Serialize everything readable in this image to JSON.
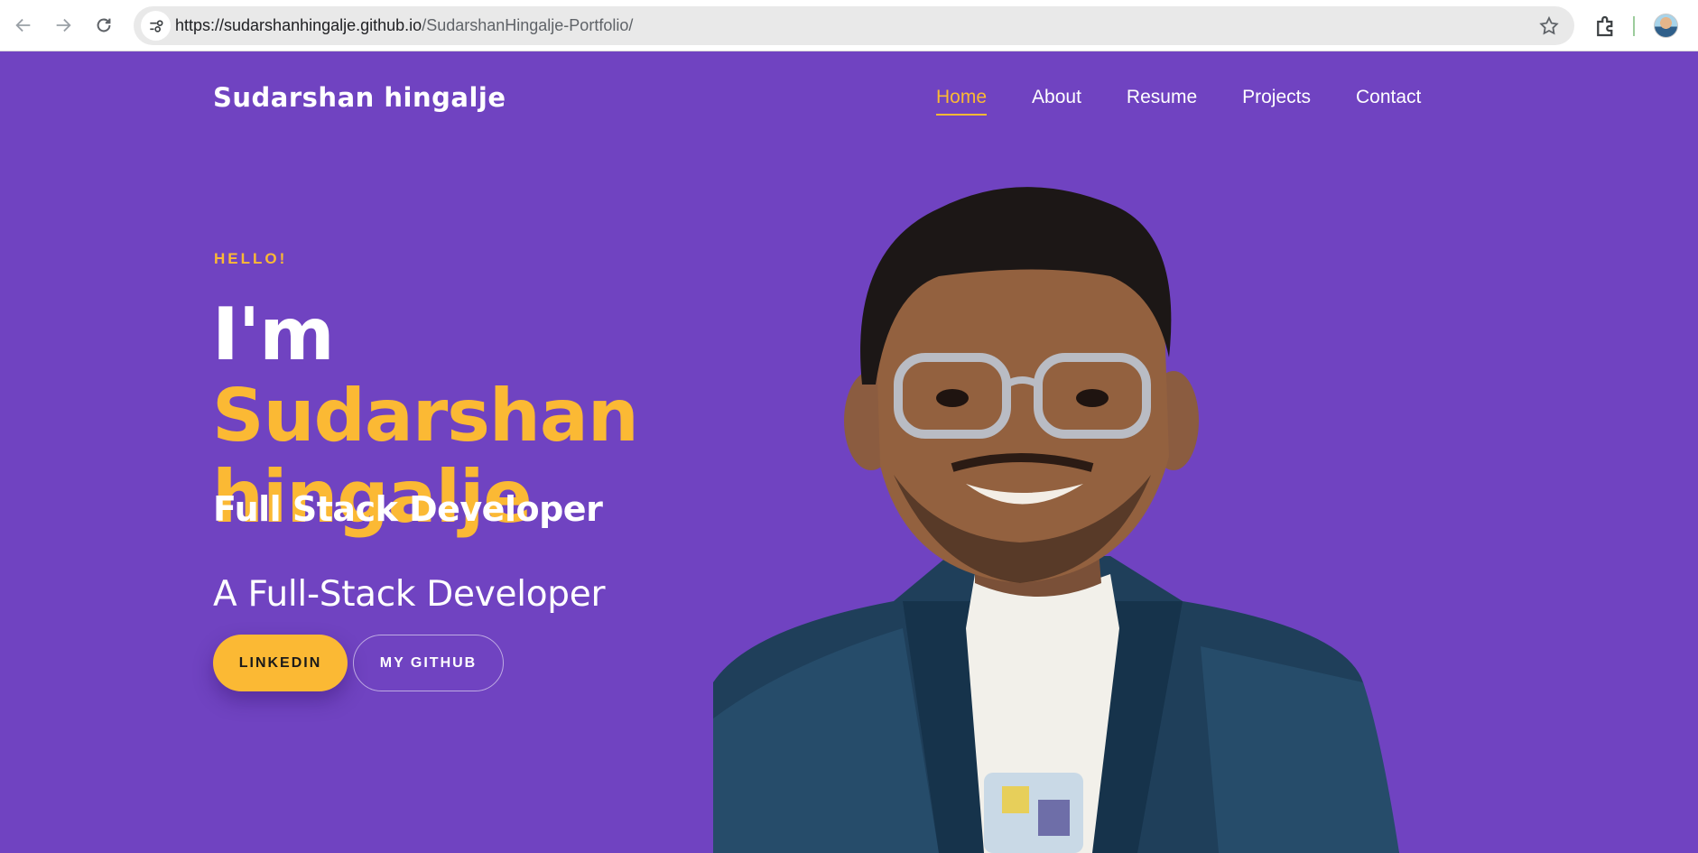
{
  "browser": {
    "url_host": "https://sudarshanhingalje.github.io",
    "url_path": "/SudarshanHingalje-Portfolio/",
    "icons": [
      "back-arrow-icon",
      "forward-arrow-icon",
      "reload-icon",
      "site-info-icon",
      "bookmark-star-icon",
      "extensions-icon",
      "profile-avatar"
    ]
  },
  "header": {
    "brand": "Sudarshan hingalje",
    "nav": [
      {
        "label": "Home",
        "active": true
      },
      {
        "label": "About",
        "active": false
      },
      {
        "label": "Resume",
        "active": false
      },
      {
        "label": "Projects",
        "active": false
      },
      {
        "label": "Contact",
        "active": false
      }
    ]
  },
  "hero": {
    "greeting": "HELLO!",
    "intro": "I'm",
    "name": "Sudarshan hingalje",
    "role": "Full Stack Developer",
    "tagline": "A Full-Stack Developer",
    "buttons": {
      "linkedin": "LINKEDIN",
      "github": "MY GITHUB"
    }
  },
  "colors": {
    "background": "#7043c1",
    "accent": "#fbb934",
    "text": "#ffffff"
  }
}
